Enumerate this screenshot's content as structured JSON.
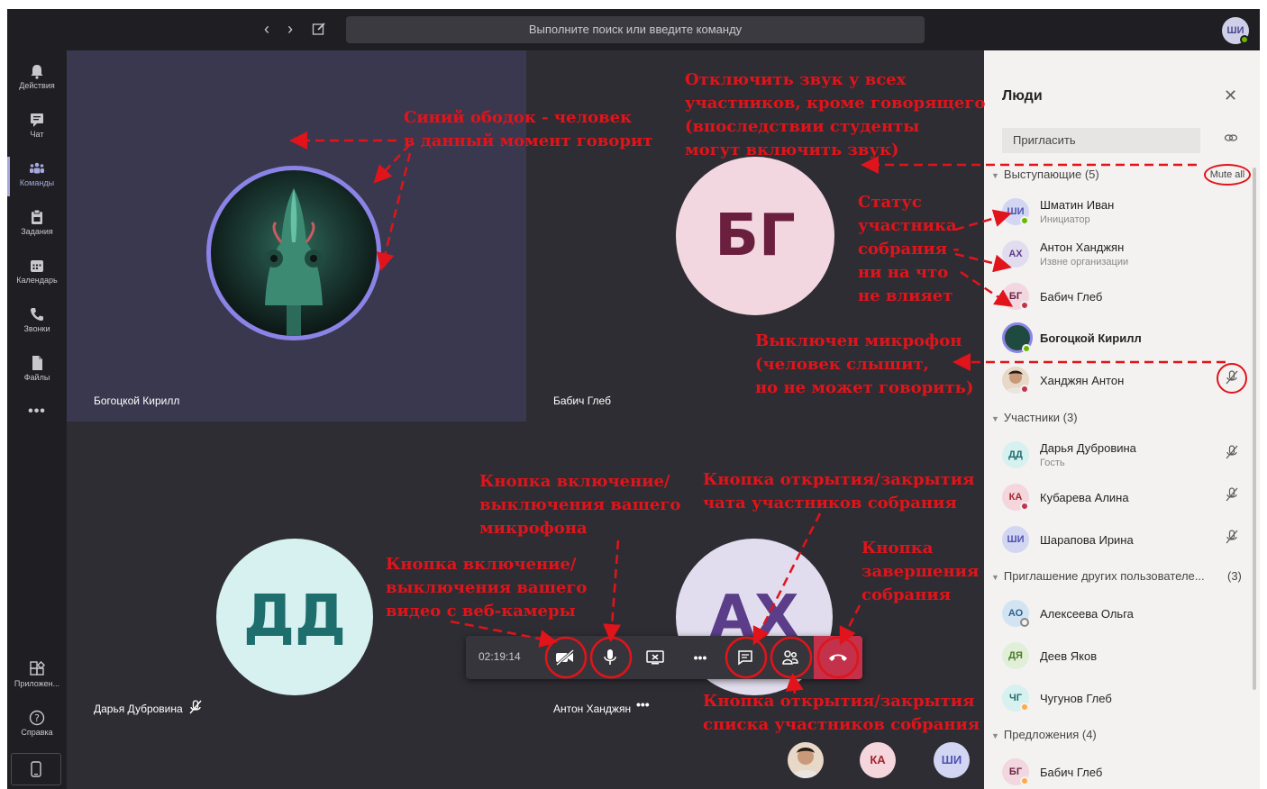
{
  "topbar": {
    "search_placeholder": "Выполните поиск или введите команду",
    "me_initials": "ШИ"
  },
  "rail": [
    {
      "label": "Действия",
      "icon": "bell-icon"
    },
    {
      "label": "Чат",
      "icon": "chat-icon"
    },
    {
      "label": "Команды",
      "icon": "teams-icon"
    },
    {
      "label": "Задания",
      "icon": "assignments-icon"
    },
    {
      "label": "Календарь",
      "icon": "calendar-icon"
    },
    {
      "label": "Звонки",
      "icon": "phone-icon"
    },
    {
      "label": "Файлы",
      "icon": "files-icon"
    },
    {
      "label": "Приложен...",
      "icon": "apps-icon"
    },
    {
      "label": "Справка",
      "icon": "help-icon"
    }
  ],
  "tiles": {
    "t1_name": "Богоцкой Кирилл",
    "t2_name": "Бабич Глеб",
    "t2_initials": "БГ",
    "t3_name": "Дарья Дубровина",
    "t3_initials": "ДД",
    "t4_name": "Антон Ханджян",
    "t4_initials": "АХ"
  },
  "controls": {
    "timer": "02:19:14"
  },
  "mini_avatars": [
    "КА",
    "ШИ"
  ],
  "panel": {
    "title": "Люди",
    "invite": "Пригласить",
    "mute_all": "Mute all",
    "presenters_header": "Выступающие (5)",
    "attendees_header": "Участники (3)",
    "invited_header": "Приглашение других пользователе...",
    "invited_count": "(3)",
    "suggestions_header": "Предложения (4)",
    "presenters": [
      {
        "initials": "ШИ",
        "name": "Шматин Иван",
        "sub": "Инициатор"
      },
      {
        "initials": "АХ",
        "name": "Антон Ханджян",
        "sub": "Извне организации"
      },
      {
        "initials": "БГ",
        "name": "Бабич Глеб",
        "sub": ""
      },
      {
        "initials": "",
        "name": "Богоцкой Кирилл",
        "sub": ""
      },
      {
        "initials": "",
        "name": "Ханджян Антон",
        "sub": ""
      }
    ],
    "attendees": [
      {
        "initials": "ДД",
        "name": "Дарья Дубровина",
        "sub": "Гость"
      },
      {
        "initials": "КА",
        "name": "Кубарева Алина",
        "sub": ""
      },
      {
        "initials": "ШИ",
        "name": "Шарапова Ирина",
        "sub": ""
      }
    ],
    "invited": [
      {
        "initials": "АО",
        "name": "Алексеева Ольга"
      },
      {
        "initials": "ДЯ",
        "name": "Деев Яков"
      },
      {
        "initials": "ЧГ",
        "name": "Чугунов Глеб"
      }
    ],
    "suggestions": [
      {
        "initials": "БГ",
        "name": "Бабич Глеб"
      }
    ]
  },
  "annotations": {
    "blue_ring": "Синий ободок - человек\nв данный момент говорит",
    "mute_all": "Отключить звук у всех\nучастников, кроме говорящего\n(впоследствии студенты\nмогут включить звук)",
    "status": "Статус\nучастника\nсобрания -\nни на что\nне влияет",
    "mic_off": "Выключен микрофон\n(человек слышит,\nно не может говорить)",
    "mic_button": "Кнопка включение/\nвыключения вашего\nмикрофона",
    "cam_button": "Кнопка включение/\nвыключения вашего\nвидео с веб-камеры",
    "chat_button": "Кнопка открытия/закрытия\nчата участников собрания",
    "end_button": "Кнопка\nзавершения\nсобрания",
    "people_button": "Кнопка открытия/закрытия\nсписка участников собрания"
  },
  "colors": {
    "annotation": "#e0141a",
    "speaking_ring": "#8b83e6",
    "hangup": "#c4314b",
    "accent": "#a6a7dc"
  }
}
